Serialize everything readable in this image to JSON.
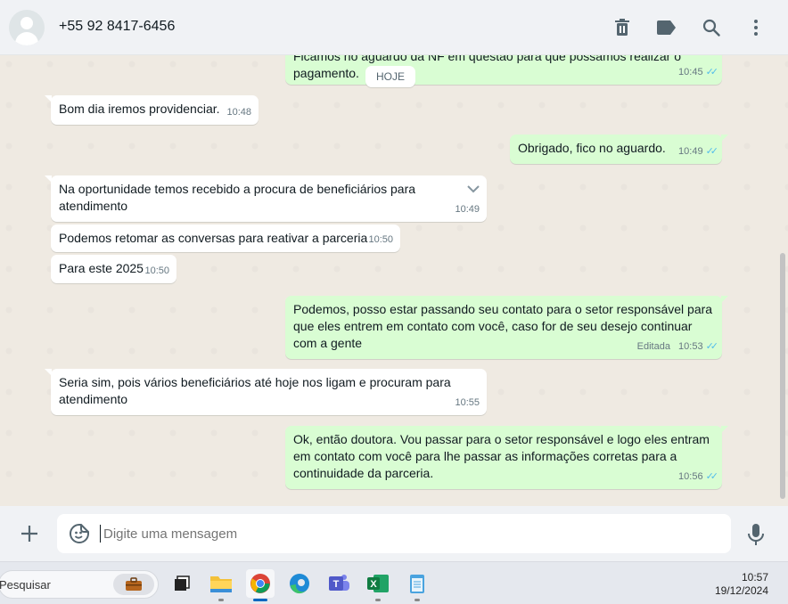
{
  "header": {
    "contact": "+55 92 8417-6456"
  },
  "chat": {
    "date_divider": "HOJE",
    "partial_top": {
      "text_top": "Ficamos no aguardo da NF em questão para que possamos realizar o",
      "text": "pagamento.",
      "time": "10:45"
    },
    "messages": [
      {
        "dir": "in",
        "text": "Bom dia iremos providenciar.",
        "time": "10:48"
      },
      {
        "dir": "out",
        "text": "Obrigado, fico no aguardo.",
        "time": "10:49"
      },
      {
        "dir": "in",
        "text": "Na oportunidade temos recebido a procura de beneficiários para atendimento",
        "time": "10:49"
      },
      {
        "dir": "in",
        "text": "Podemos retomar as conversas para reativar a parceria",
        "time": "10:50"
      },
      {
        "dir": "in",
        "text": "Para este 2025",
        "time": "10:50"
      },
      {
        "dir": "out",
        "text": "Podemos, posso estar passando seu contato para o setor responsável para que eles entrem em contato com você, caso for de seu desejo continuar com a gente",
        "time": "10:53",
        "edited": "Editada"
      },
      {
        "dir": "in",
        "text": "Seria sim, pois vários beneficiários até hoje nos ligam e procuram para atendimento",
        "time": "10:55"
      },
      {
        "dir": "out",
        "text": "Ok, então doutora. Vou passar para o setor responsável e logo eles entram em contato com você para lhe passar as informações corretas para a continuidade da parceria.",
        "time": "10:56"
      }
    ]
  },
  "compose": {
    "placeholder": "Digite uma mensagem"
  },
  "taskbar": {
    "search": "Pesquisar",
    "time": "10:57",
    "date": "19/12/2024"
  },
  "colors": {
    "incoming": "#ffffff",
    "outgoing": "#d9fdd3",
    "read_ticks": "#53bdeb",
    "background": "#efeae2"
  }
}
